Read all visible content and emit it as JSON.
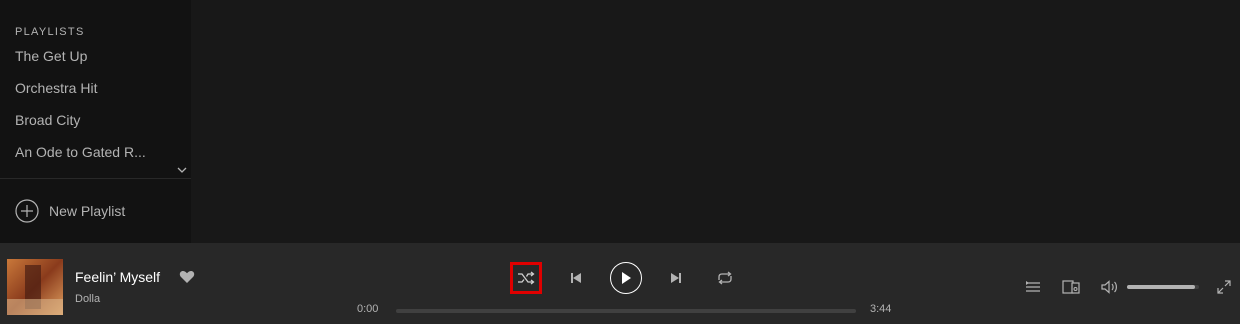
{
  "sidebar": {
    "section_title": "PLAYLISTS",
    "playlists": [
      "The Get Up",
      "Orchestra Hit",
      "Broad City",
      "An Ode to Gated R..."
    ],
    "new_playlist_label": "New Playlist"
  },
  "player": {
    "track_title": "Feelin’ Myself",
    "track_artist": "Dolla",
    "time_current": "0:00",
    "time_total": "3:44",
    "progress_fraction": 0.0,
    "volume_fraction": 0.95,
    "controls": [
      "shuffle-icon",
      "previous-icon",
      "play-icon",
      "next-icon",
      "repeat-icon"
    ],
    "right_controls": [
      "queue-icon",
      "devices-icon",
      "volume-icon",
      "fullscreen-icon"
    ],
    "highlight_color": "#e00000"
  }
}
